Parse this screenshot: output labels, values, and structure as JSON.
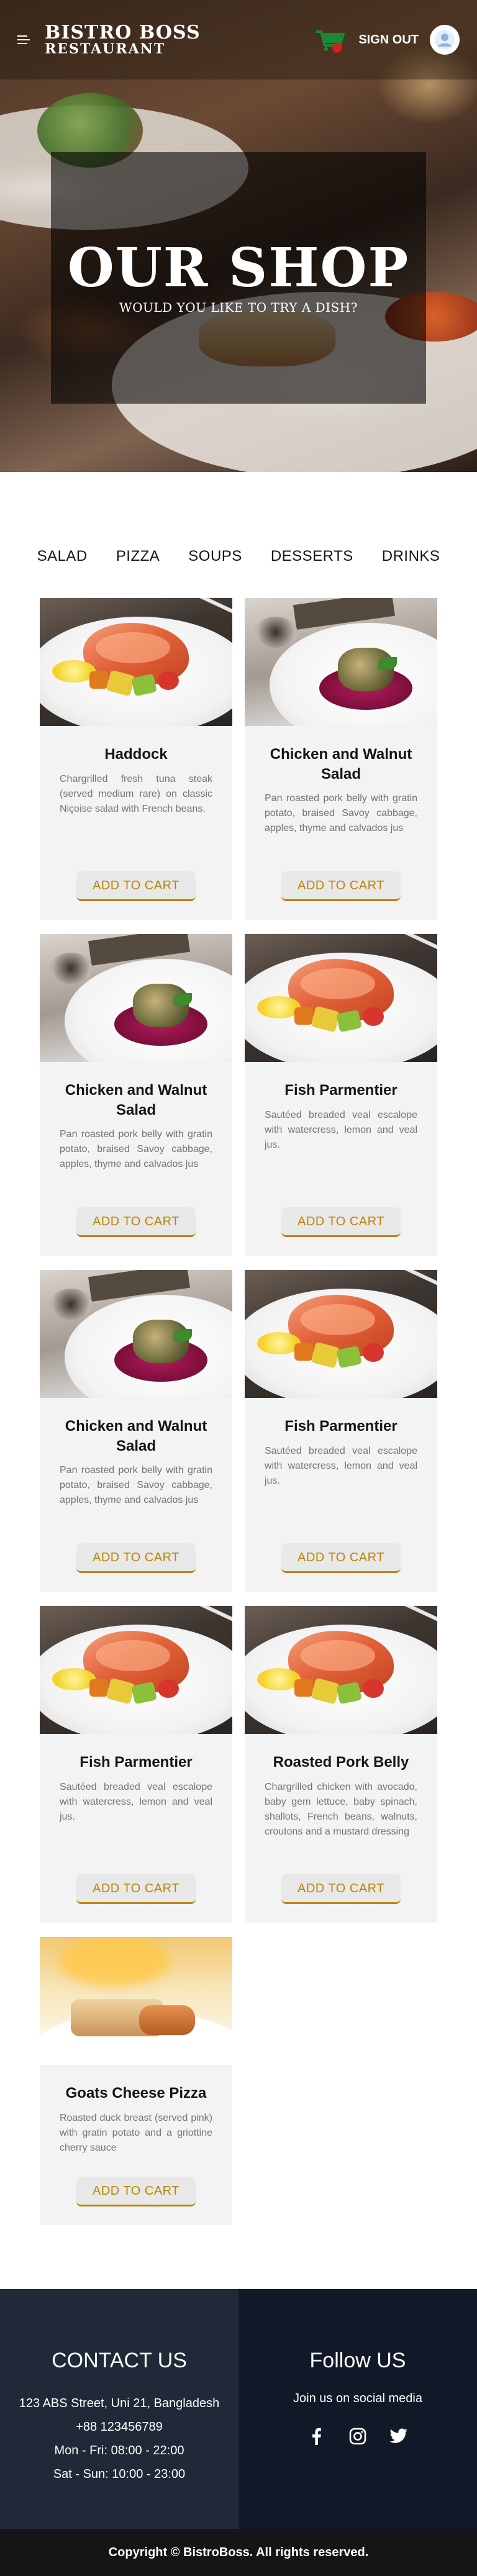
{
  "navbar": {
    "logo_line1": "BISTRO BOSS",
    "logo_line2": "RESTAURANT",
    "signout_label": "SIGN OUT"
  },
  "hero": {
    "title": "OUR SHOP",
    "subtitle": "WOULD YOU LIKE TO TRY A DISH?"
  },
  "tabs": [
    "SALAD",
    "PIZZA",
    "SOUPS",
    "DESSERTS",
    "DRINKS"
  ],
  "cards": [
    {
      "name": "Haddock",
      "desc": "Chargrilled fresh tuna steak (served medium rare) on classic Niçoise salad with French beans.",
      "button": "ADD TO CART",
      "image": "salmon"
    },
    {
      "name": "Chicken and Walnut Salad",
      "desc": "Pan roasted pork belly with gratin potato, braised Savoy cabbage, apples, thyme and calvados jus",
      "button": "ADD TO CART",
      "image": "walnut"
    },
    {
      "name": "Chicken and Walnut Salad",
      "desc": "Pan roasted pork belly with gratin potato, braised Savoy cabbage, apples, thyme and calvados jus",
      "button": "ADD TO CART",
      "image": "walnut"
    },
    {
      "name": "Fish Parmentier",
      "desc": "Sautéed breaded veal escalope with watercress, lemon and veal jus.",
      "button": "ADD TO CART",
      "image": "salmon"
    },
    {
      "name": "Chicken and Walnut Salad",
      "desc": "Pan roasted pork belly with gratin potato, braised Savoy cabbage, apples, thyme and calvados jus",
      "button": "ADD TO CART",
      "image": "walnut"
    },
    {
      "name": "Fish Parmentier",
      "desc": "Sautéed breaded veal escalope with watercress, lemon and veal jus.",
      "button": "ADD TO CART",
      "image": "salmon"
    },
    {
      "name": "Fish Parmentier",
      "desc": "Sautéed breaded veal escalope with watercress, lemon and veal jus.",
      "button": "ADD TO CART",
      "image": "salmon"
    },
    {
      "name": "Roasted Pork Belly",
      "desc": "Chargrilled chicken with avocado, baby gem lettuce, baby spinach, shallots, French beans, walnuts, croutons and a mustard dressing",
      "button": "ADD TO CART",
      "image": "salmon"
    },
    {
      "name": "Goats Cheese Pizza",
      "desc": "Roasted duck breast (served pink) with gratin potato and a griottine cherry sauce",
      "button": "ADD TO CART",
      "image": "pizza"
    }
  ],
  "footer": {
    "contact_title": "CONTACT US",
    "address": "123 ABS Street, Uni 21, Bangladesh",
    "phone": "+88 123456789",
    "hours_weekday": "Mon - Fri: 08:00 - 22:00",
    "hours_weekend": "Sat - Sun: 10:00 - 23:00",
    "follow_title": "Follow US",
    "follow_text": "Join us on social media",
    "copyright": "Copyright © BistroBoss. All rights reserved."
  },
  "colors": {
    "accent": "#bb8506",
    "card_bg": "#f3f3f3",
    "footer_left": "#1f2937",
    "footer_right": "#111827",
    "copyright_bg": "#151515"
  },
  "icons": [
    "hamburger-menu-icon",
    "cart-icon",
    "user-avatar-icon",
    "facebook-icon",
    "instagram-icon",
    "twitter-icon"
  ]
}
